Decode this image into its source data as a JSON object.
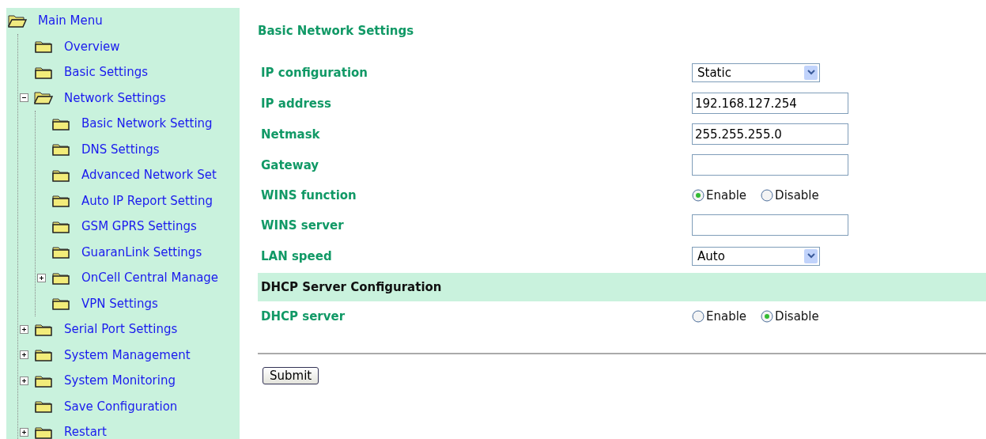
{
  "sidebar": {
    "title": "Main Menu",
    "items": [
      {
        "label": "Overview",
        "kind": "leaf"
      },
      {
        "label": "Basic Settings",
        "kind": "leaf"
      },
      {
        "label": "Network Settings",
        "kind": "branch",
        "expanded": true,
        "children": [
          {
            "label": "Basic Network Setting",
            "kind": "leaf"
          },
          {
            "label": "DNS Settings",
            "kind": "leaf"
          },
          {
            "label": "Advanced Network Set",
            "kind": "leaf"
          },
          {
            "label": "Auto IP Report Setting",
            "kind": "leaf"
          },
          {
            "label": "GSM GPRS Settings",
            "kind": "leaf"
          },
          {
            "label": "GuaranLink Settings",
            "kind": "leaf"
          },
          {
            "label": "OnCell Central Manage",
            "kind": "branch",
            "expanded": false
          },
          {
            "label": "VPN Settings",
            "kind": "leaf"
          }
        ]
      },
      {
        "label": "Serial Port Settings",
        "kind": "branch",
        "expanded": false
      },
      {
        "label": "System Management",
        "kind": "branch",
        "expanded": false
      },
      {
        "label": "System Monitoring",
        "kind": "branch",
        "expanded": false
      },
      {
        "label": "Save Configuration",
        "kind": "leaf"
      },
      {
        "label": "Restart",
        "kind": "branch",
        "expanded": false
      }
    ]
  },
  "form": {
    "title": "Basic Network Settings",
    "rows": [
      {
        "kind": "select",
        "label": "IP configuration",
        "value": "Static"
      },
      {
        "kind": "text",
        "label": "IP address",
        "value": "192.168.127.254"
      },
      {
        "kind": "text",
        "label": "Netmask",
        "value": "255.255.255.0"
      },
      {
        "kind": "text",
        "label": "Gateway"
      },
      {
        "kind": "radio",
        "label": "WINS function",
        "options": [
          {
            "label": "Enable",
            "selected": true
          },
          {
            "label": "Disable",
            "selected": false
          }
        ]
      },
      {
        "kind": "text",
        "label": "WINS server"
      },
      {
        "kind": "select",
        "label": "LAN speed",
        "value": "Auto"
      },
      {
        "kind": "section",
        "label": "DHCP Server Configuration"
      },
      {
        "kind": "radio",
        "label": "DHCP server",
        "options": [
          {
            "label": "Enable",
            "selected": false
          },
          {
            "label": "Disable",
            "selected": true
          }
        ]
      }
    ],
    "submit": "Submit"
  }
}
